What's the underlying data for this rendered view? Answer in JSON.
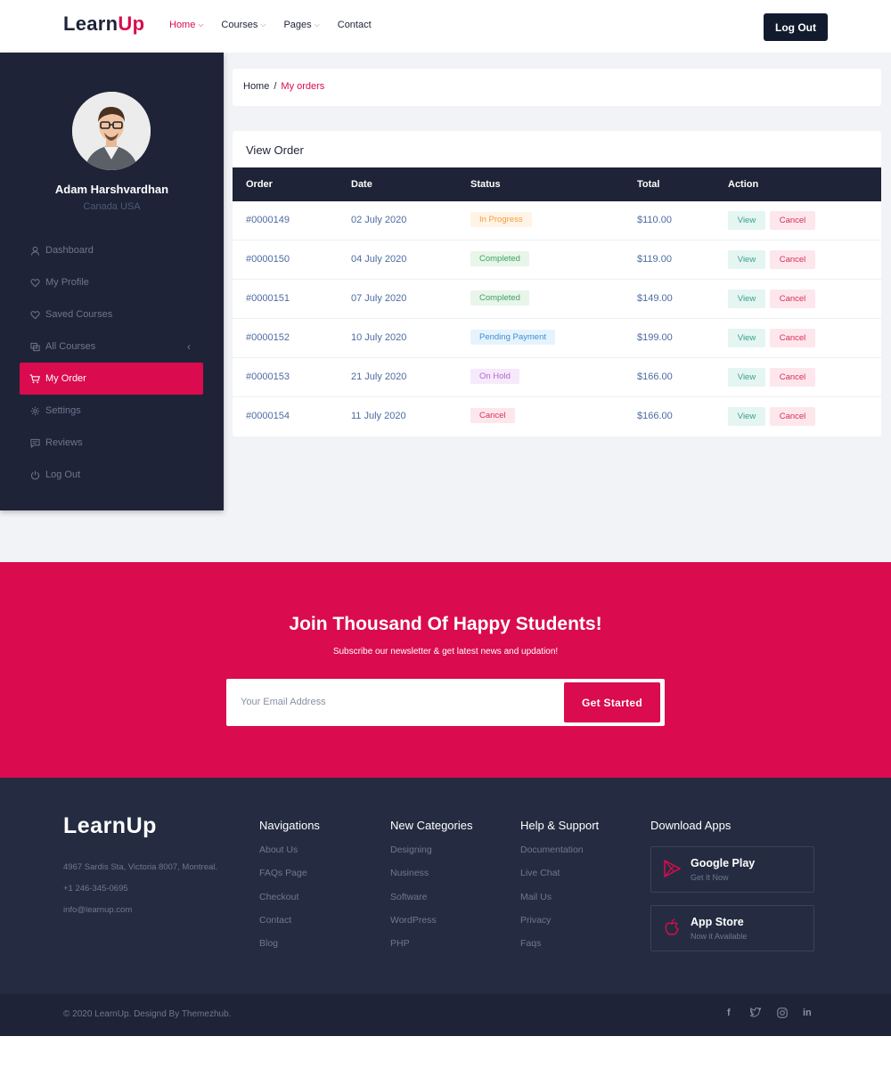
{
  "header": {
    "logo_main": "Learn",
    "logo_accent": "Up",
    "nav": [
      {
        "label": "Home",
        "active": true,
        "has_caret": true
      },
      {
        "label": "Courses",
        "active": false,
        "has_caret": true
      },
      {
        "label": "Pages",
        "active": false,
        "has_caret": true
      },
      {
        "label": "Contact",
        "active": false,
        "has_caret": false
      }
    ],
    "logout_label": "Log Out"
  },
  "sidebar": {
    "user_name": "Adam Harshvardhan",
    "user_location": "Canada USA",
    "items": [
      {
        "label": "Dashboard",
        "icon": "user-icon",
        "active": false
      },
      {
        "label": "My Profile",
        "icon": "heart-icon",
        "active": false
      },
      {
        "label": "Saved Courses",
        "icon": "heart-icon",
        "active": false
      },
      {
        "label": "All Courses",
        "icon": "courses-icon",
        "active": false,
        "caret": "‹"
      },
      {
        "label": "My Order",
        "icon": "cart-icon",
        "active": true
      },
      {
        "label": "Settings",
        "icon": "gear-icon",
        "active": false
      },
      {
        "label": "Reviews",
        "icon": "chat-icon",
        "active": false
      },
      {
        "label": "Log Out",
        "icon": "power-icon",
        "active": false
      }
    ]
  },
  "breadcrumb": {
    "home": "Home",
    "separator": "/",
    "current": "My orders"
  },
  "orders": {
    "title": "View Order",
    "columns": [
      "Order",
      "Date",
      "Status",
      "Total",
      "Action"
    ],
    "rows": [
      {
        "order": "#0000149",
        "date": "02 July 2020",
        "status": "In Progress",
        "status_type": "progress",
        "total": "$110.00",
        "view": "View",
        "cancel": "Cancel"
      },
      {
        "order": "#0000150",
        "date": "04 July 2020",
        "status": "Completed",
        "status_type": "completed",
        "total": "$119.00",
        "view": "View",
        "cancel": "Cancel"
      },
      {
        "order": "#0000151",
        "date": "07 July 2020",
        "status": "Completed",
        "status_type": "completed",
        "total": "$149.00",
        "view": "View",
        "cancel": "Cancel"
      },
      {
        "order": "#0000152",
        "date": "10 July 2020",
        "status": "Pending Payment",
        "status_type": "pending",
        "total": "$199.00",
        "view": "View",
        "cancel": "Cancel"
      },
      {
        "order": "#0000153",
        "date": "21 July 2020",
        "status": "On Hold",
        "status_type": "hold",
        "total": "$166.00",
        "view": "View",
        "cancel": "Cancel"
      },
      {
        "order": "#0000154",
        "date": "11 July 2020",
        "status": "Cancel",
        "status_type": "cancel",
        "total": "$166.00",
        "view": "View",
        "cancel": "Cancel"
      }
    ]
  },
  "newsletter": {
    "title": "Join Thousand Of Happy Students!",
    "subtitle": "Subscribe our newsletter & get latest news and updation!",
    "email_placeholder": "Your Email Address",
    "button_label": "Get Started"
  },
  "footer": {
    "logo": "LearnUp",
    "address": "4967 Sardis Sta, Victoria 8007, Montreal.",
    "phone": "+1 246-345-0695",
    "email": "info@learnup.com",
    "columns": [
      {
        "title": "Navigations",
        "links": [
          "About Us",
          "FAQs Page",
          "Checkout",
          "Contact",
          "Blog"
        ]
      },
      {
        "title": "New Categories",
        "links": [
          "Designing",
          "Nusiness",
          "Software",
          "WordPress",
          "PHP"
        ]
      },
      {
        "title": "Help & Support",
        "links": [
          "Documentation",
          "Live Chat",
          "Mail Us",
          "Privacy",
          "Faqs"
        ]
      }
    ],
    "apps_title": "Download Apps",
    "apps": [
      {
        "name": "Google Play",
        "sub": "Get It Now",
        "icon": "play-store-icon"
      },
      {
        "name": "App Store",
        "sub": "Now it Available",
        "icon": "apple-icon"
      }
    ],
    "copyright": "© 2020 LearnUp. Designd By Themezhub.",
    "social": [
      "facebook-icon",
      "twitter-icon",
      "instagram-icon",
      "linkedin-icon"
    ]
  },
  "colors": {
    "accent": "#da0b4e",
    "dark": "#1e2337",
    "footer": "#252c41"
  }
}
